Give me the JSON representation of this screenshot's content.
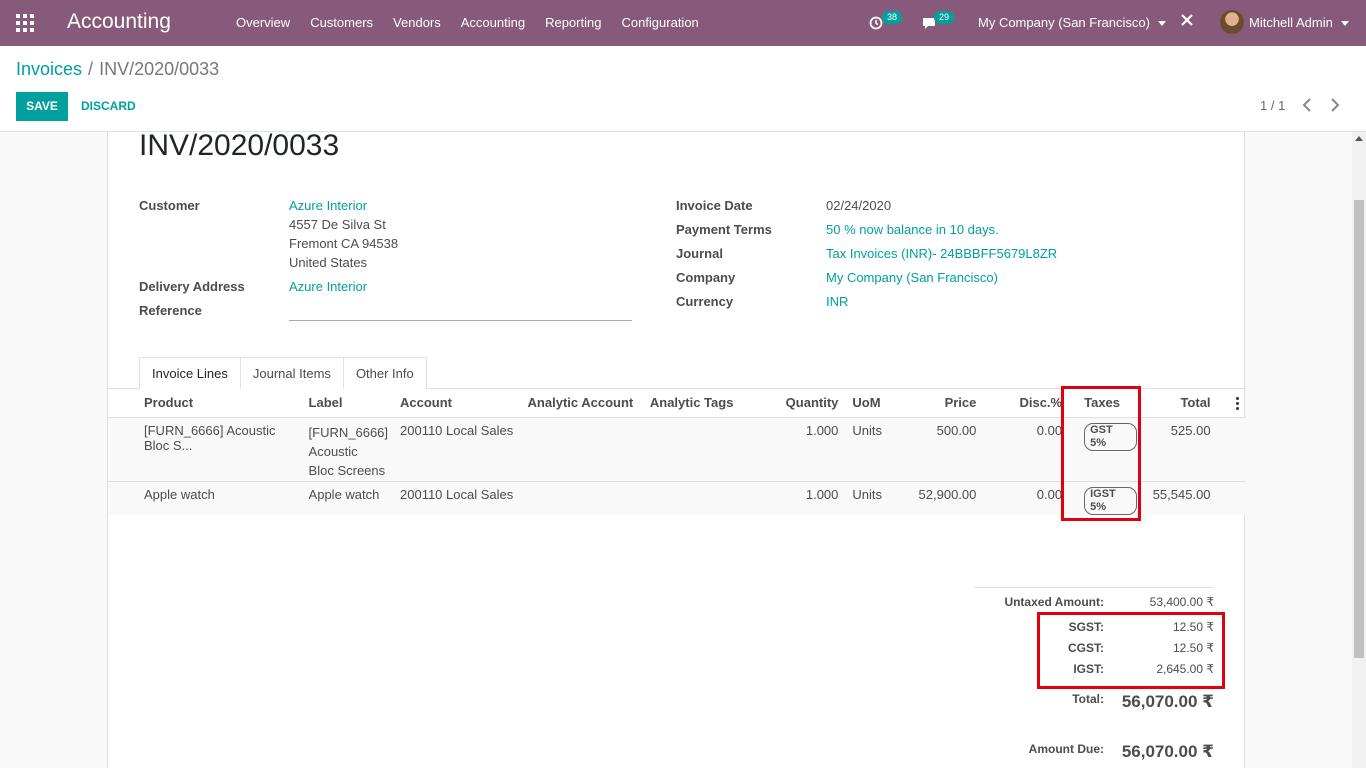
{
  "navbar": {
    "brand": "Accounting",
    "menu": [
      "Overview",
      "Customers",
      "Vendors",
      "Accounting",
      "Reporting",
      "Configuration"
    ],
    "activity_count": "38",
    "message_count": "29",
    "company": "My Company (San Francisco)",
    "user": "Mitchell Admin",
    "accent": "#875a7b"
  },
  "control": {
    "breadcrumb_parent": "Invoices",
    "breadcrumb_sep": "/",
    "breadcrumb_current": "INV/2020/0033",
    "save_label": "SAVE",
    "discard_label": "DISCARD",
    "pager": "1 / 1",
    "accent": "#00a09d"
  },
  "invoice": {
    "number": "INV/2020/0033",
    "customer_label": "Customer",
    "customer_name": "Azure Interior",
    "customer_address": [
      "4557 De Silva St",
      "Fremont CA 94538",
      "United States"
    ],
    "delivery_label": "Delivery Address",
    "delivery_value": "Azure Interior",
    "reference_label": "Reference",
    "date_label": "Invoice Date",
    "date_value": "02/24/2020",
    "terms_label": "Payment Terms",
    "terms_value": "50 % now balance in 10 days.",
    "journal_label": "Journal",
    "journal_value": "Tax Invoices (INR)- 24BBBFF5679L8ZR",
    "company_label": "Company",
    "company_value": "My Company (San Francisco)",
    "currency_label": "Currency",
    "currency_value": "INR"
  },
  "tabs": [
    "Invoice Lines",
    "Journal Items",
    "Other Info"
  ],
  "lines": {
    "headers": [
      "Product",
      "Label",
      "Account",
      "Analytic Account",
      "Analytic Tags",
      "Quantity",
      "UoM",
      "Price",
      "Disc.%",
      "Taxes",
      "Total"
    ],
    "rows": [
      {
        "product": "[FURN_6666] Acoustic Bloc S...",
        "label_lines": [
          "[FURN_6666]",
          "Acoustic",
          "Bloc Screens"
        ],
        "account": "200110 Local Sales",
        "quantity": "1.000",
        "uom": "Units",
        "price": "500.00",
        "disc": "0.00",
        "tax": "GST 5%",
        "total": "525.00"
      },
      {
        "product": "Apple watch",
        "label_lines": [
          "Apple watch"
        ],
        "account": "200110 Local Sales",
        "quantity": "1.000",
        "uom": "Units",
        "price": "52,900.00",
        "disc": "0.00",
        "tax": "IGST 5%",
        "total": "55,545.00"
      }
    ]
  },
  "totals": {
    "untaxed_label": "Untaxed Amount:",
    "untaxed_value": "53,400.00 ₹",
    "sgst_label": "SGST:",
    "sgst_value": "12.50 ₹",
    "cgst_label": "CGST:",
    "cgst_value": "12.50 ₹",
    "igst_label": "IGST:",
    "igst_value": "2,645.00 ₹",
    "total_label": "Total:",
    "total_value": "56,070.00 ₹",
    "due_label": "Amount Due:",
    "due_value": "56,070.00 ₹"
  },
  "highlight_color": "#e2000f"
}
